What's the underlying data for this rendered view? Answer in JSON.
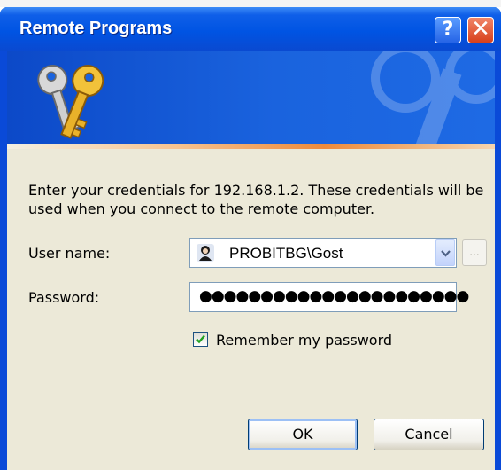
{
  "window": {
    "title": "Remote Programs"
  },
  "titlebar": {
    "help_glyph": "?",
    "close_glyph": "✕"
  },
  "icons": {
    "banner": "keys-icon",
    "user": "user-account-icon",
    "dropdown": "chevron-down-icon",
    "check": "checkmark-icon"
  },
  "dialog": {
    "description": "Enter your credentials for 192.168.1.2. These credentials will be used when you connect to the remote computer.",
    "username_label": "User name:",
    "username_value": "PROBITBG\\Gost",
    "browse_label": "...",
    "password_label": "Password:",
    "password_mask": "●●●●●●●●●●●●●●●●●●●●●●",
    "remember_label": "Remember my password",
    "remember_checked": true,
    "ok_label": "OK",
    "cancel_label": "Cancel"
  },
  "colors": {
    "titlebar": "#0054e3",
    "client": "#ece9d8",
    "accent": "#ee8a3a"
  }
}
